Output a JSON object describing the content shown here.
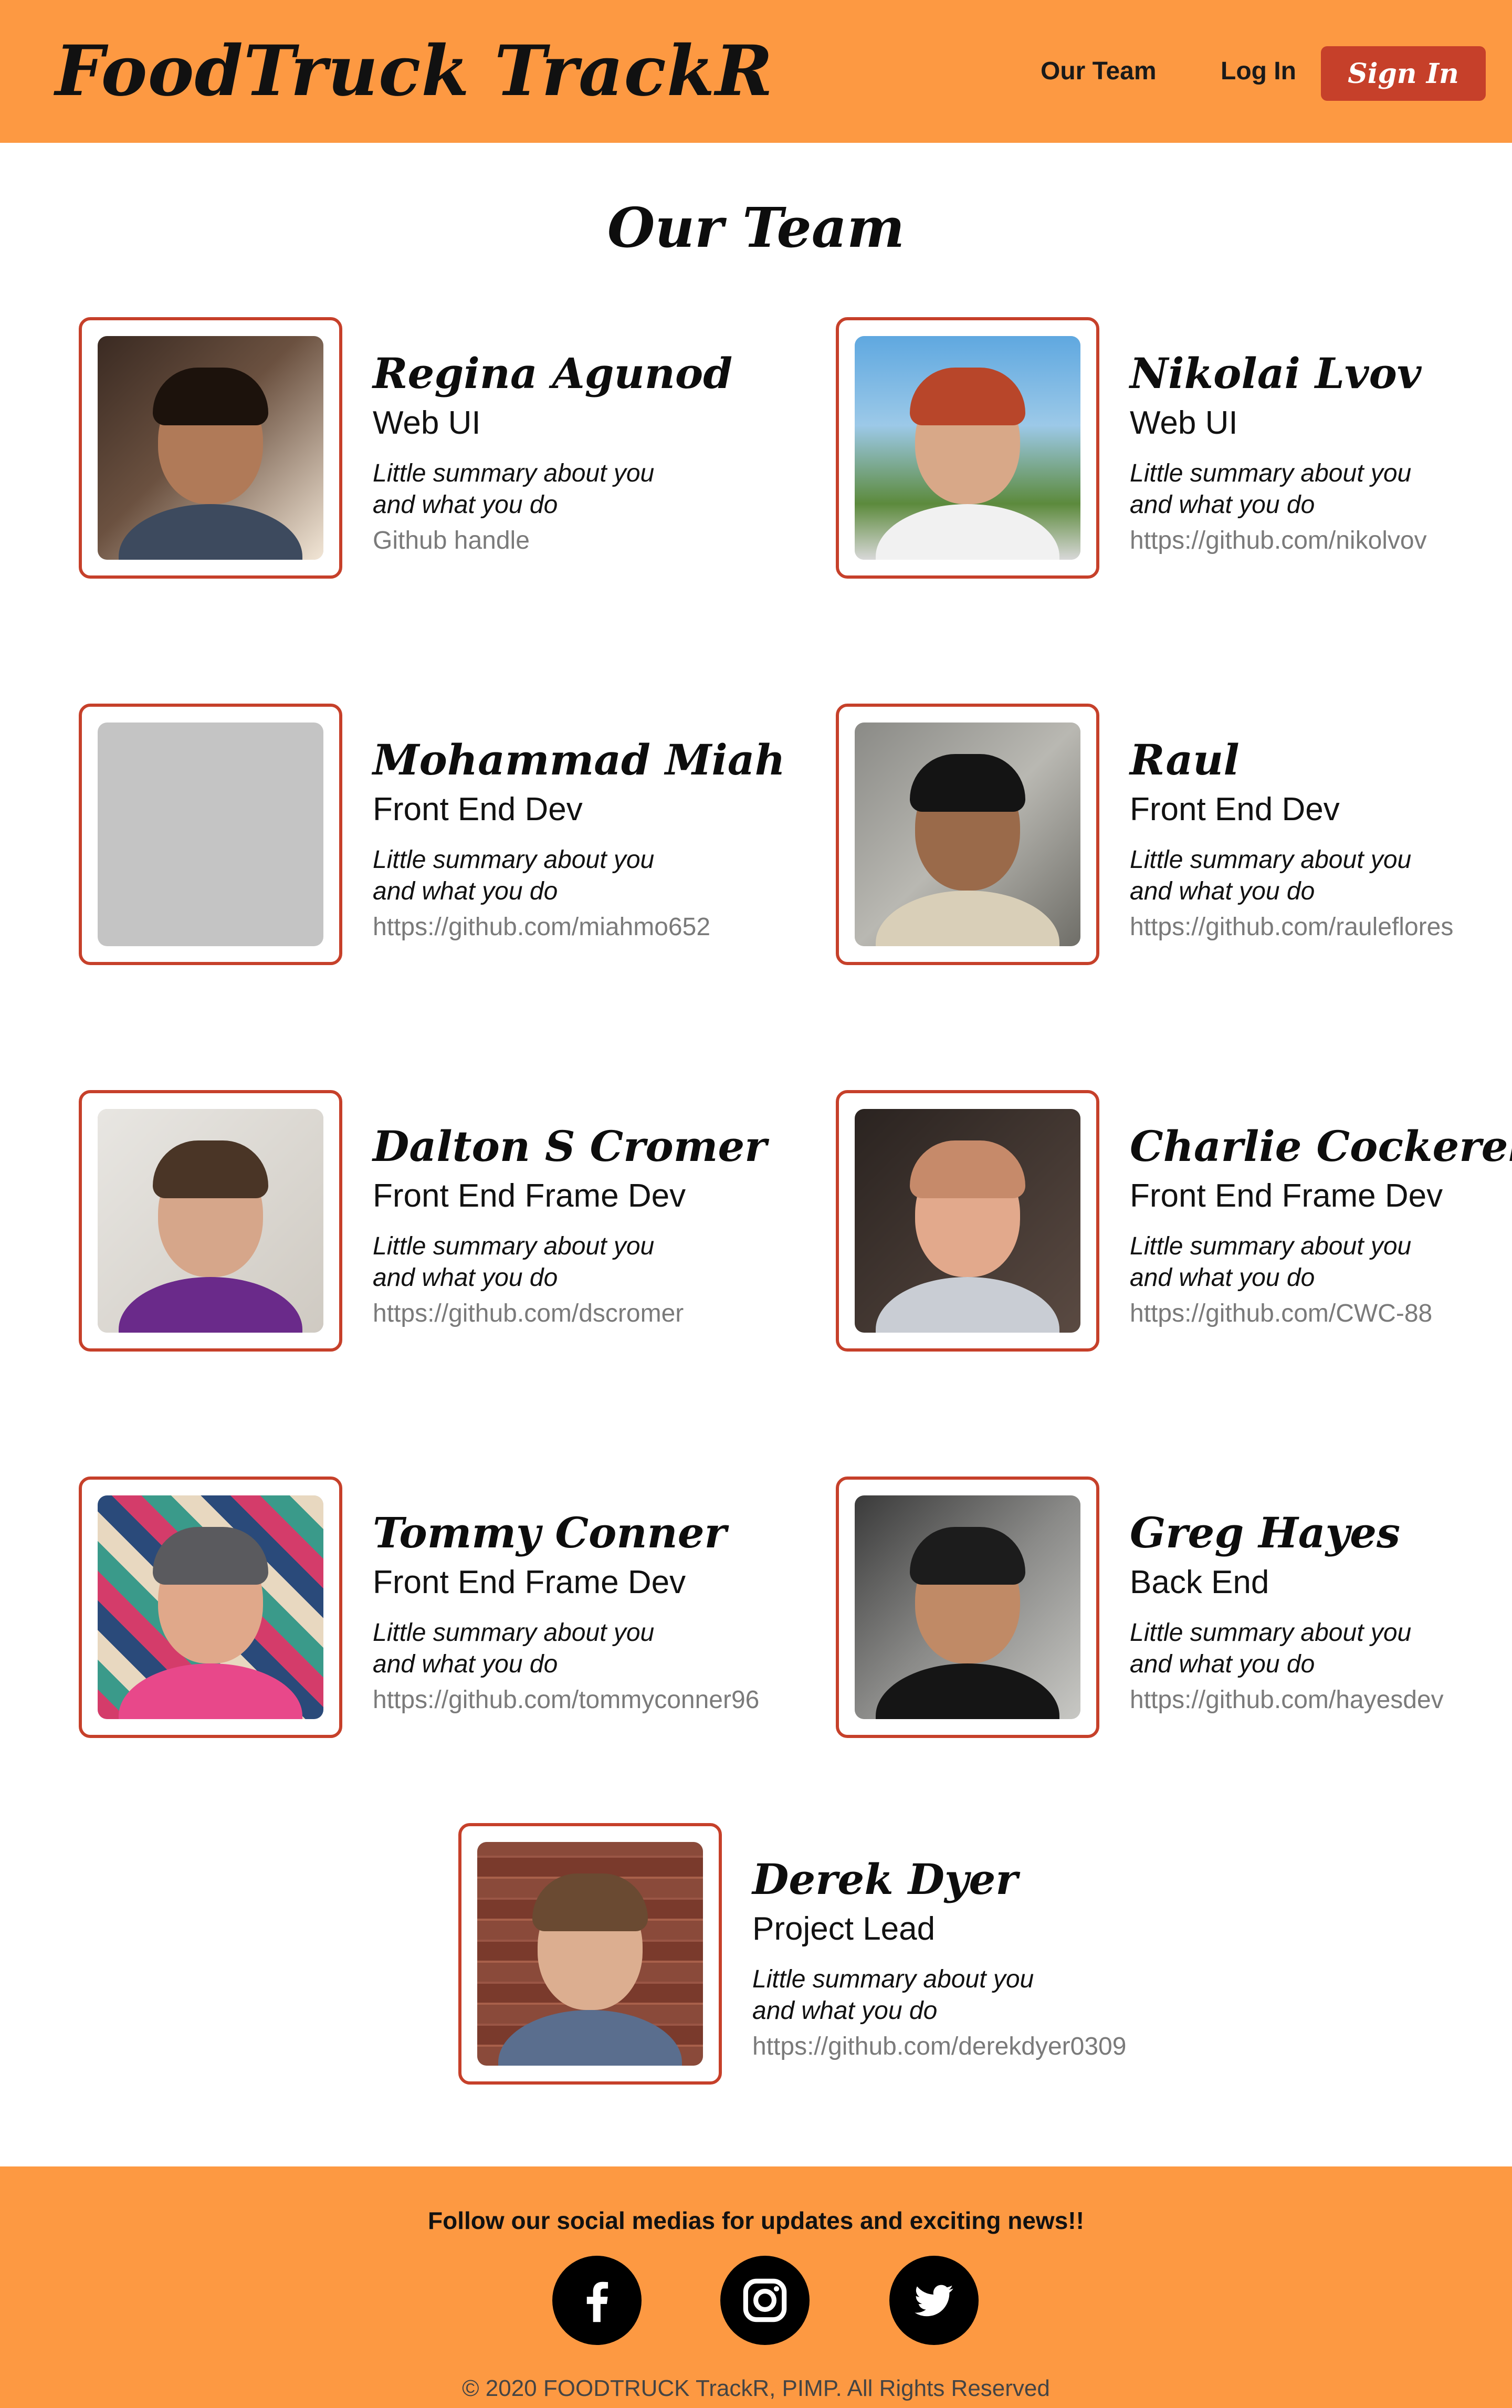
{
  "brand": {
    "logo": "FoodTruck TrackR",
    "accent_color": "#fd9942",
    "button_color": "#c6402a"
  },
  "nav": {
    "team_label": "Our Team",
    "login_label": "Log In",
    "signin_label": "Sign In"
  },
  "page": {
    "title": "Our Team"
  },
  "members": [
    {
      "name": "Regina Agunod",
      "role": "Web UI",
      "summary_1": "Little summary about you",
      "summary_2": "and what you do",
      "github": "Github handle"
    },
    {
      "name": "Nikolai Lvov",
      "role": "Web UI",
      "summary_1": "Little summary about you",
      "summary_2": "and what you do",
      "github": "https://github.com/nikolvov"
    },
    {
      "name": "Mohammad Miah",
      "role": "Front End Dev",
      "summary_1": "Little summary about you",
      "summary_2": "and what you do",
      "github": "https://github.com/miahmo652"
    },
    {
      "name": "Raul",
      "role": "Front End Dev",
      "summary_1": "Little summary about you",
      "summary_2": "and what you do",
      "github": "https://github.com/rauleflores"
    },
    {
      "name": "Dalton S Cromer",
      "role": "Front End Frame Dev",
      "summary_1": "Little summary about you",
      "summary_2": "and what you do",
      "github": "https://github.com/dscromer"
    },
    {
      "name": "Charlie Cockerell",
      "role": "Front End Frame Dev",
      "summary_1": "Little summary about you",
      "summary_2": "and what you do",
      "github": "https://github.com/CWC-88"
    },
    {
      "name": "Tommy Conner",
      "role": "Front End Frame Dev",
      "summary_1": "Little summary about you",
      "summary_2": "and what you do",
      "github": "https://github.com/tommyconner96"
    },
    {
      "name": "Greg Hayes",
      "role": "Back End",
      "summary_1": "Little summary about you",
      "summary_2": "and what you do",
      "github": "https://github.com/hayesdev"
    },
    {
      "name": "Derek Dyer",
      "role": "Project Lead",
      "summary_1": "Little summary about you",
      "summary_2": "and what you do",
      "github": "https://github.com/derekdyer0309"
    }
  ],
  "footer": {
    "message": "Follow our social medias for updates and exciting news!!",
    "socials": [
      "facebook-icon",
      "instagram-icon",
      "twitter-icon"
    ],
    "copyright": "© 2020 FOODTRUCK TrackR, PIMP. All Rights Reserved"
  }
}
